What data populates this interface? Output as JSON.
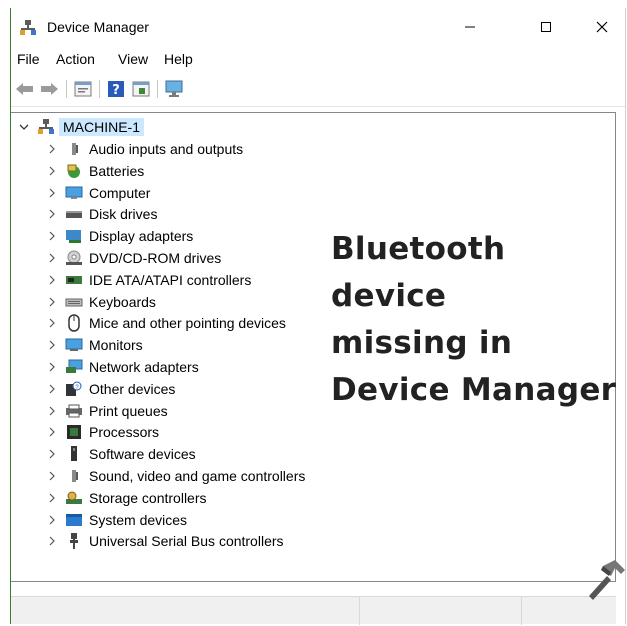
{
  "window": {
    "title": "Device Manager",
    "controls": {
      "minimize": "—",
      "maximize": "☐",
      "close": "✕"
    }
  },
  "menu": {
    "items": [
      "File",
      "Action",
      "View",
      "Help"
    ]
  },
  "toolbar": {
    "buttons": [
      "back-arrow-icon",
      "forward-arrow-icon",
      "properties-icon",
      "help-icon",
      "update-driver-icon",
      "scan-hardware-icon"
    ]
  },
  "tree": {
    "root": "MACHINE-1",
    "items": [
      {
        "label": "Audio inputs and outputs",
        "icon": "speaker-icon"
      },
      {
        "label": "Batteries",
        "icon": "battery-icon"
      },
      {
        "label": "Computer",
        "icon": "computer-icon"
      },
      {
        "label": "Disk drives",
        "icon": "disk-drive-icon"
      },
      {
        "label": "Display adapters",
        "icon": "display-adapter-icon"
      },
      {
        "label": "DVD/CD-ROM drives",
        "icon": "dvd-drive-icon"
      },
      {
        "label": "IDE ATA/ATAPI controllers",
        "icon": "ide-controller-icon"
      },
      {
        "label": "Keyboards",
        "icon": "keyboard-icon"
      },
      {
        "label": "Mice and other pointing devices",
        "icon": "mouse-icon"
      },
      {
        "label": "Monitors",
        "icon": "monitor-icon"
      },
      {
        "label": "Network adapters",
        "icon": "network-adapter-icon"
      },
      {
        "label": "Other devices",
        "icon": "other-devices-icon"
      },
      {
        "label": "Print queues",
        "icon": "printer-icon"
      },
      {
        "label": "Processors",
        "icon": "processor-icon"
      },
      {
        "label": "Software devices",
        "icon": "software-device-icon"
      },
      {
        "label": "Sound, video and game controllers",
        "icon": "sound-controller-icon"
      },
      {
        "label": "Storage controllers",
        "icon": "storage-controller-icon"
      },
      {
        "label": "System devices",
        "icon": "system-devices-icon"
      },
      {
        "label": "Universal Serial Bus controllers",
        "icon": "usb-icon"
      }
    ]
  },
  "overlay": {
    "lines": [
      "Bluetooth",
      "device",
      "missing in",
      "Device Manager"
    ]
  },
  "colors": {
    "selection": "#cce8ff",
    "tree_border": "#828790",
    "accent_green": "#3a7d2f"
  }
}
